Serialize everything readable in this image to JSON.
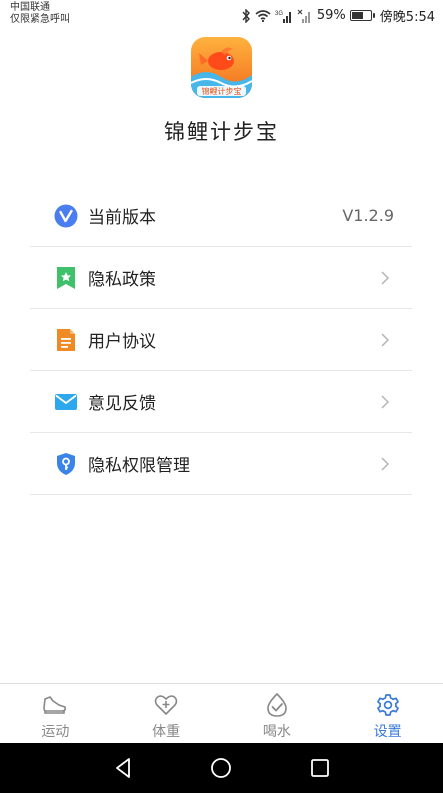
{
  "statusbar": {
    "carrier_line1": "中国联通",
    "carrier_line2": "仅限紧急呼叫",
    "battery_percent": "59%",
    "battery_level": 0.59,
    "time": "傍晚5:54",
    "network_badge": "3G"
  },
  "app": {
    "logo_text": "锦鲤计步宝",
    "name": "锦鲤计步宝"
  },
  "menu": {
    "items": [
      {
        "label": "当前版本",
        "value": "V1.2.9",
        "icon": "version-v-icon",
        "color": "#4a7ef0"
      },
      {
        "label": "隐私政策",
        "icon": "privacy-policy-icon",
        "color": "#3fc06b"
      },
      {
        "label": "用户协议",
        "icon": "document-icon",
        "color": "#f08a24"
      },
      {
        "label": "意见反馈",
        "icon": "mail-icon",
        "color": "#2ea8ec"
      },
      {
        "label": "隐私权限管理",
        "icon": "shield-key-icon",
        "color": "#3a84e8"
      }
    ]
  },
  "tabs": [
    {
      "label": "运动",
      "icon": "shoe-icon",
      "active": false
    },
    {
      "label": "体重",
      "icon": "heart-plus-icon",
      "active": false
    },
    {
      "label": "喝水",
      "icon": "check-drop-icon",
      "active": false
    },
    {
      "label": "设置",
      "icon": "gear-icon",
      "active": true
    }
  ],
  "colors": {
    "accent": "#3a7bd5",
    "inactive_tab": "#888888",
    "divider": "#e8e8e8"
  }
}
